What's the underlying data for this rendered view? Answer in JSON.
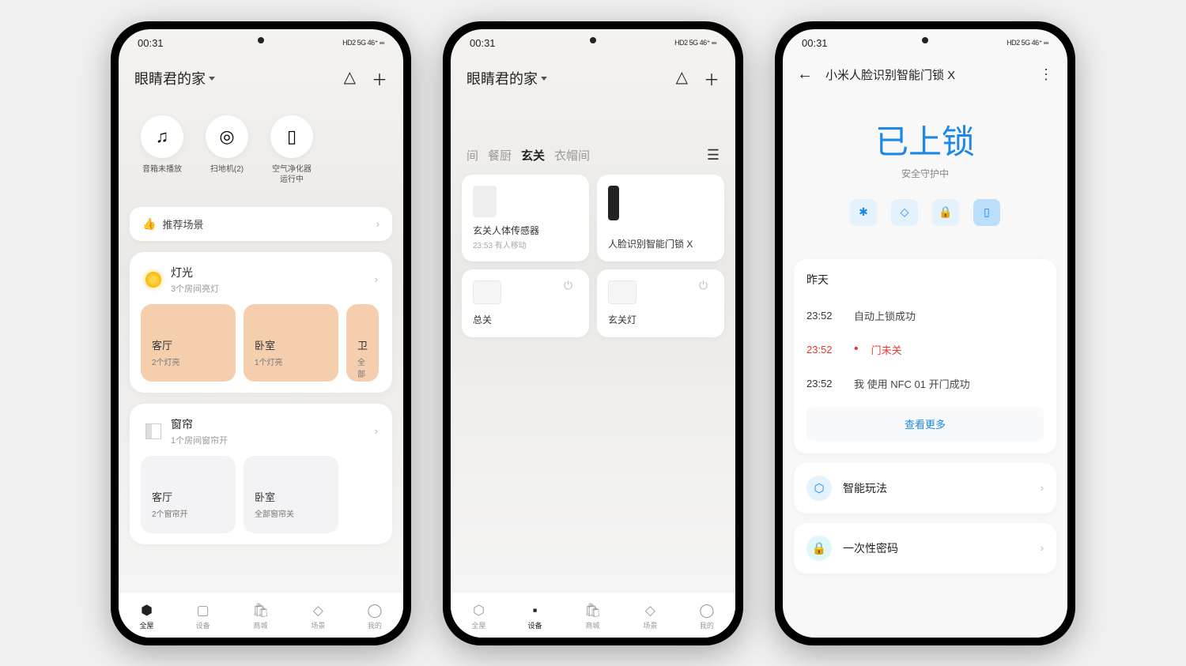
{
  "statusBar": {
    "time": "00:31",
    "indicators": "HD2 5G 46⁺ ⬫⬫⬫"
  },
  "screen1": {
    "header": {
      "homeName": "眼睛君的家"
    },
    "quick": [
      {
        "icon": "♫",
        "label": "音箱未播放"
      },
      {
        "icon": "◎",
        "label": "扫地机(2)"
      },
      {
        "icon": "▯",
        "label": "空气净化器\n运行中"
      }
    ],
    "sceneCard": {
      "label": "推荐场景"
    },
    "lightGroup": {
      "title": "灯光",
      "sub": "3个房间亮灯",
      "tiles": [
        {
          "title": "客厅",
          "sub": "2个灯亮"
        },
        {
          "title": "卧室",
          "sub": "1个灯亮"
        },
        {
          "title": "卫",
          "sub": "全部"
        }
      ]
    },
    "curtainGroup": {
      "title": "窗帘",
      "sub": "1个房间窗帘开",
      "tiles": [
        {
          "title": "客厅",
          "sub": "2个窗帘开"
        },
        {
          "title": "卧室",
          "sub": "全部窗帘关"
        }
      ]
    },
    "nav": [
      "全屋",
      "设备",
      "商城",
      "场景",
      "我的"
    ]
  },
  "screen2": {
    "header": {
      "homeName": "眼睛君的家"
    },
    "tabs": [
      "间",
      "餐厨",
      "玄关",
      "衣帽间"
    ],
    "activeTab": "玄关",
    "devices": [
      {
        "name": "玄关人体传感器",
        "status": "23:53 有人移动"
      },
      {
        "name": "人脸识别智能门锁 X",
        "status": ""
      },
      {
        "name": "总关",
        "status": "",
        "hasPower": true
      },
      {
        "name": "玄关灯",
        "status": "",
        "hasPower": true
      }
    ],
    "nav": [
      "全屋",
      "设备",
      "商城",
      "场景",
      "我的"
    ]
  },
  "screen3": {
    "title": "小米人脸识别智能门锁 X",
    "lockStatus": "已上锁",
    "lockSub": "安全守护中",
    "iconRow": [
      "✱",
      "◇",
      "🔒",
      "▯"
    ],
    "log": {
      "day": "昨天",
      "entries": [
        {
          "time": "23:52",
          "text": "自动上锁成功",
          "alert": false
        },
        {
          "time": "23:52",
          "text": "门未关",
          "alert": true
        },
        {
          "time": "23:52",
          "text": "我 使用 NFC 01 开门成功",
          "alert": false
        }
      ],
      "more": "查看更多"
    },
    "settings": [
      {
        "icon": "⬡",
        "label": "智能玩法",
        "color": "blue"
      },
      {
        "icon": "🔒",
        "label": "一次性密码",
        "color": "teal"
      }
    ]
  }
}
